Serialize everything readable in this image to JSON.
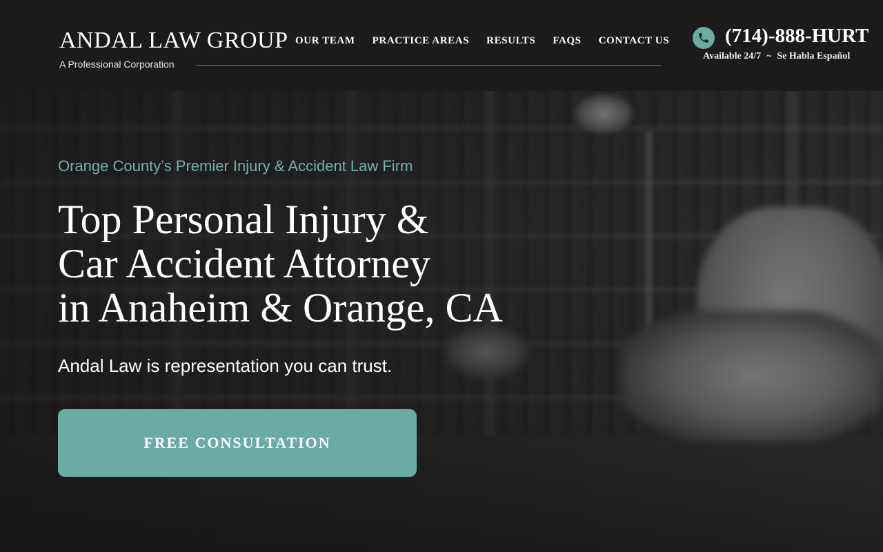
{
  "header": {
    "logo_title": "ANDAL LAW GROUP",
    "logo_subtitle": "A Professional Corporation",
    "nav": [
      "OUR TEAM",
      "PRACTICE AREAS",
      "RESULTS",
      "FAQS",
      "CONTACT US"
    ],
    "phone_icon": "phone-icon",
    "phone": "(714)-888-HURT",
    "availability": "Available 24/7",
    "separator": "~",
    "spanish": "Se Habla Español"
  },
  "hero": {
    "tagline": "Orange County’s Premier Injury & Accident Law Firm",
    "headline": [
      "Top Personal Injury &",
      "Car Accident Attorney",
      "in Anaheim & Orange, CA"
    ],
    "subline": "Andal Law is representation you can trust.",
    "cta_label": "FREE CONSULTATION"
  },
  "colors": {
    "accent": "#6aaba5",
    "tagline": "#6fb4ad",
    "header_bg": "#1b1b1b"
  }
}
